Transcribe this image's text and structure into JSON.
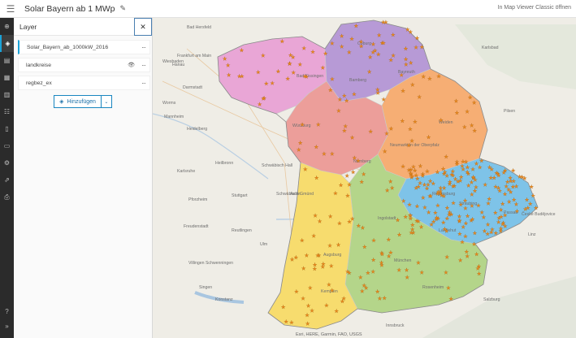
{
  "header": {
    "title": "Solar Bayern ab 1 MWp",
    "classic_link": "In Map Viewer Classic öffnen"
  },
  "panel": {
    "title": "Layer",
    "layers": [
      {
        "name": "Solar_Bayern_ab_1000kW_2016",
        "visible_icon": false
      },
      {
        "name": "landkreise",
        "visible_icon": true
      },
      {
        "name": "regbez_ex",
        "visible_icon": false
      }
    ],
    "add_label": "Hinzufügen"
  },
  "map": {
    "attribution": "Esri, HERE, Garmin, FAO, USGS",
    "place_labels": [
      [
        "Bad Hersfeld",
        230,
        35
      ],
      [
        "Hanau",
        212,
        81
      ],
      [
        "Frankfurt am Main",
        218,
        70
      ],
      [
        "Wiesbaden",
        200,
        77
      ],
      [
        "Darmstadt",
        225,
        109
      ],
      [
        "Worms",
        200,
        128
      ],
      [
        "Mannheim",
        202,
        145
      ],
      [
        "Heidelberg",
        230,
        160
      ],
      [
        "Karlsruhe",
        218,
        212
      ],
      [
        "Heilbronn",
        265,
        202
      ],
      [
        "Schwäbisch Hall",
        322,
        205
      ],
      [
        "Stuttgart",
        285,
        242
      ],
      [
        "Pforzheim",
        232,
        247
      ],
      [
        "Reutlingen",
        285,
        285
      ],
      [
        "Ulm",
        320,
        302
      ],
      [
        "Freudenstadt",
        226,
        280
      ],
      [
        "Villingen Schwenningen",
        232,
        325
      ],
      [
        "Singen",
        245,
        355
      ],
      [
        "Konstanz",
        265,
        370
      ],
      [
        "Würzburg",
        360,
        156
      ],
      [
        "Nürnberg",
        435,
        200
      ],
      [
        "Bamberg",
        430,
        100
      ],
      [
        "Bayreuth",
        490,
        90
      ],
      [
        "Regensburg",
        532,
        240
      ],
      [
        "Ingolstadt",
        465,
        270
      ],
      [
        "Augsburg",
        398,
        315
      ],
      [
        "München",
        485,
        322
      ],
      [
        "Landshut",
        540,
        285
      ],
      [
        "Passau",
        620,
        263
      ],
      [
        "Rosenheim",
        520,
        355
      ],
      [
        "Kempten",
        395,
        360
      ],
      [
        "Karlsbad",
        593,
        60
      ],
      [
        "Pilsen",
        620,
        138
      ],
      [
        "České Budějovice",
        642,
        265
      ],
      [
        "Linz",
        650,
        290
      ],
      [
        "Salzburg",
        595,
        370
      ],
      [
        "Innsbruck",
        475,
        402
      ],
      [
        "Coburg",
        440,
        55
      ],
      [
        "Schwäbisch Gmünd",
        340,
        240
      ],
      [
        "Aalen",
        357,
        240
      ],
      [
        "Straubing",
        565,
        252
      ],
      [
        "Bad Kissingen",
        365,
        95
      ],
      [
        "Neumarkt in der Oberpfalz",
        480,
        180
      ],
      [
        "Weiden",
        540,
        152
      ]
    ]
  }
}
